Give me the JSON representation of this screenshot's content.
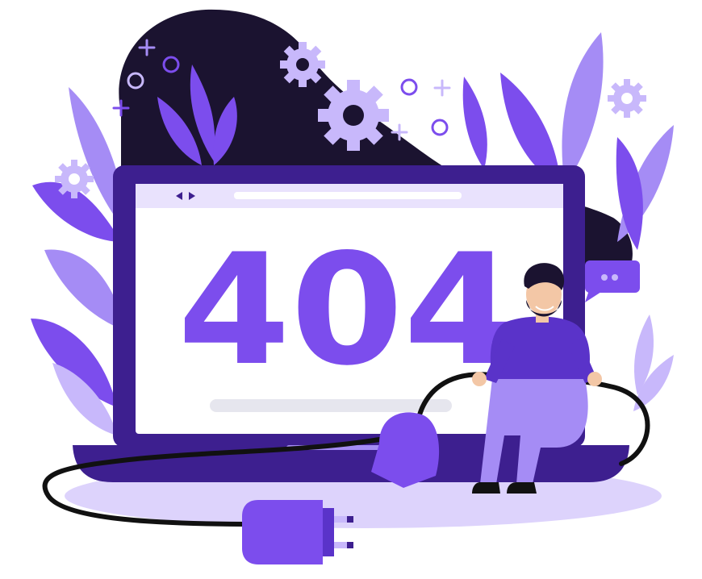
{
  "illustration": {
    "error_code": "404"
  },
  "colors": {
    "primary": "#7c4ded",
    "primary_dark": "#3d1f8f",
    "lavender": "#a58cf5",
    "lavender_light": "#c8b8fb",
    "blob_dark": "#1b1330",
    "screen_bg": "#ffffff",
    "screen_top_bar": "#e9e2fd",
    "floor_shadow": "#ddd3fc",
    "cable": "#111111"
  },
  "icons": [
    "gear-icon",
    "sparkle-icon",
    "ring-icon",
    "leaf-icon",
    "chat-bubble-icon",
    "plug-icon",
    "person-figure"
  ]
}
